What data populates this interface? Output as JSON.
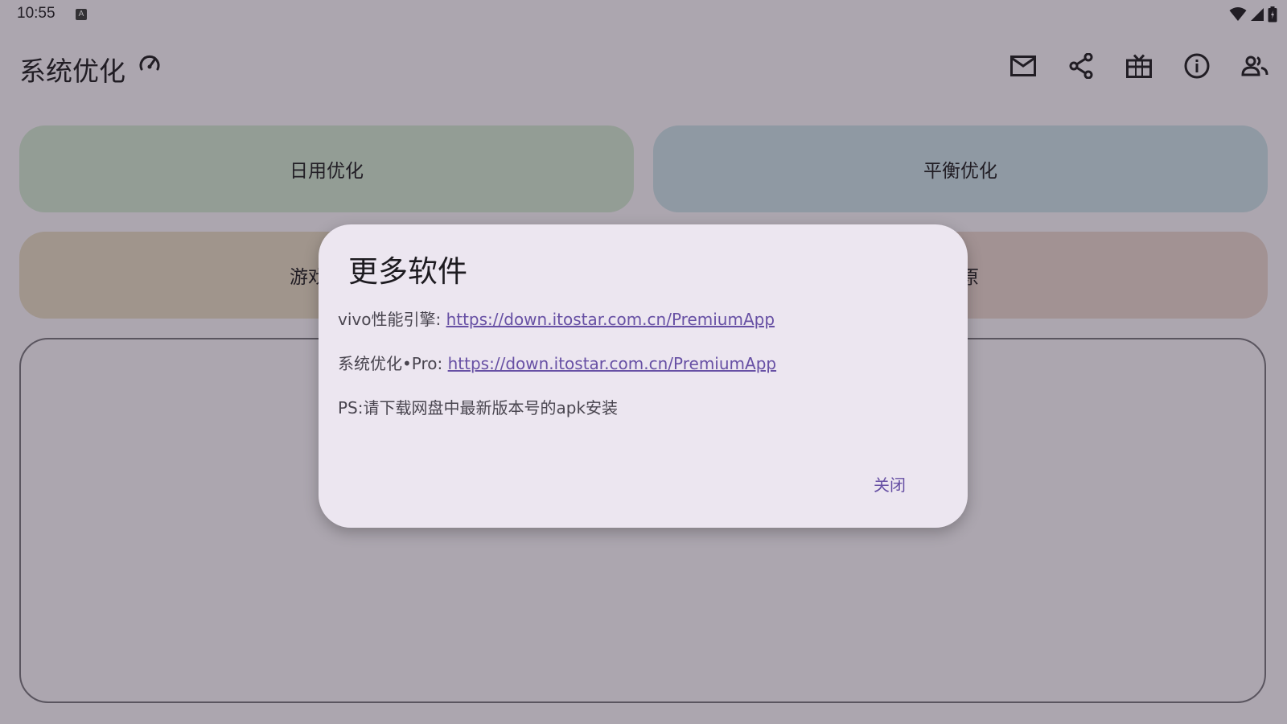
{
  "status_bar": {
    "time": "10:55",
    "notification_badge": "A"
  },
  "app_bar": {
    "title": "系统优化",
    "actions": [
      "mail-icon",
      "share-icon",
      "gift-icon",
      "info-icon",
      "group-icon"
    ]
  },
  "tiles": {
    "daily": "日用优化",
    "balance": "平衡优化",
    "game": "游戏优化",
    "restore": "还原"
  },
  "dialog": {
    "title": "更多软件",
    "line1_label": "vivo性能引擎: ",
    "line1_link": "https://down.itostar.com.cn/PremiumApp",
    "line2_label": "系统优化•Pro: ",
    "line2_link": "https://down.itostar.com.cn/PremiumApp",
    "note": "PS:请下载网盘中最新版本号的apk安装",
    "close_label": "关闭"
  },
  "colors": {
    "tile_daily": "#d6e8d6",
    "tile_balance": "#cfe2ec",
    "tile_game": "#ebdcc7",
    "tile_restore": "#eed7d2",
    "dialog_bg": "#ece6f0",
    "link": "#6750a4"
  }
}
